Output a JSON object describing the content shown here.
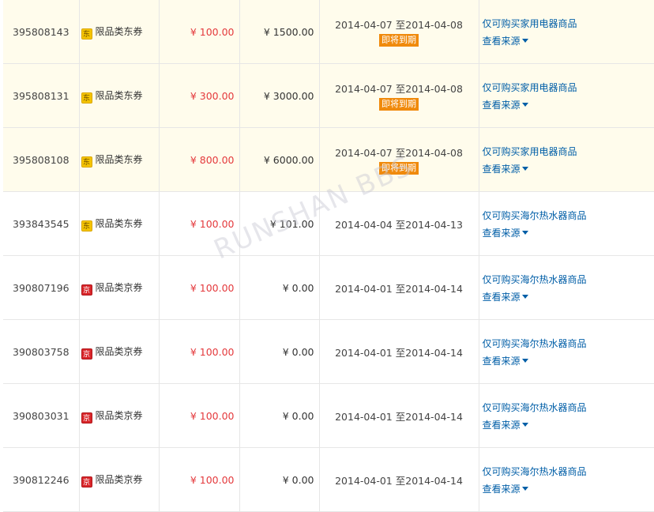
{
  "currency_symbol": "¥",
  "date_separator": "至",
  "expire_label": "即将到期",
  "source_label": "查看来源",
  "watermark": "RUNSHAN BBS",
  "badge_colors": {
    "dong": "#f5c400",
    "jing": "#d9262a"
  },
  "rows": [
    {
      "id": "395808143",
      "badge": "东",
      "badge_style": "dong",
      "type": "限品类东券",
      "face_value": "100.00",
      "min_spend": "1500.00",
      "start": "2014-04-07",
      "end": "2014-04-08",
      "expiring": true,
      "scope": "仅可购买家用电器商品"
    },
    {
      "id": "395808131",
      "badge": "东",
      "badge_style": "dong",
      "type": "限品类东券",
      "face_value": "300.00",
      "min_spend": "3000.00",
      "start": "2014-04-07",
      "end": "2014-04-08",
      "expiring": true,
      "scope": "仅可购买家用电器商品"
    },
    {
      "id": "395808108",
      "badge": "东",
      "badge_style": "dong",
      "type": "限品类东券",
      "face_value": "800.00",
      "min_spend": "6000.00",
      "start": "2014-04-07",
      "end": "2014-04-08",
      "expiring": true,
      "scope": "仅可购买家用电器商品"
    },
    {
      "id": "393843545",
      "badge": "东",
      "badge_style": "dong",
      "type": "限品类东券",
      "face_value": "100.00",
      "min_spend": "101.00",
      "start": "2014-04-04",
      "end": "2014-04-13",
      "expiring": false,
      "scope": "仅可购买海尔热水器商品"
    },
    {
      "id": "390807196",
      "badge": "京",
      "badge_style": "jing",
      "type": "限品类京券",
      "face_value": "100.00",
      "min_spend": "0.00",
      "start": "2014-04-01",
      "end": "2014-04-14",
      "expiring": false,
      "scope": "仅可购买海尔热水器商品"
    },
    {
      "id": "390803758",
      "badge": "京",
      "badge_style": "jing",
      "type": "限品类京券",
      "face_value": "100.00",
      "min_spend": "0.00",
      "start": "2014-04-01",
      "end": "2014-04-14",
      "expiring": false,
      "scope": "仅可购买海尔热水器商品"
    },
    {
      "id": "390803031",
      "badge": "京",
      "badge_style": "jing",
      "type": "限品类京券",
      "face_value": "100.00",
      "min_spend": "0.00",
      "start": "2014-04-01",
      "end": "2014-04-14",
      "expiring": false,
      "scope": "仅可购买海尔热水器商品"
    },
    {
      "id": "390812246",
      "badge": "京",
      "badge_style": "jing",
      "type": "限品类京券",
      "face_value": "100.00",
      "min_spend": "0.00",
      "start": "2014-04-01",
      "end": "2014-04-14",
      "expiring": false,
      "scope": "仅可购买海尔热水器商品"
    }
  ]
}
